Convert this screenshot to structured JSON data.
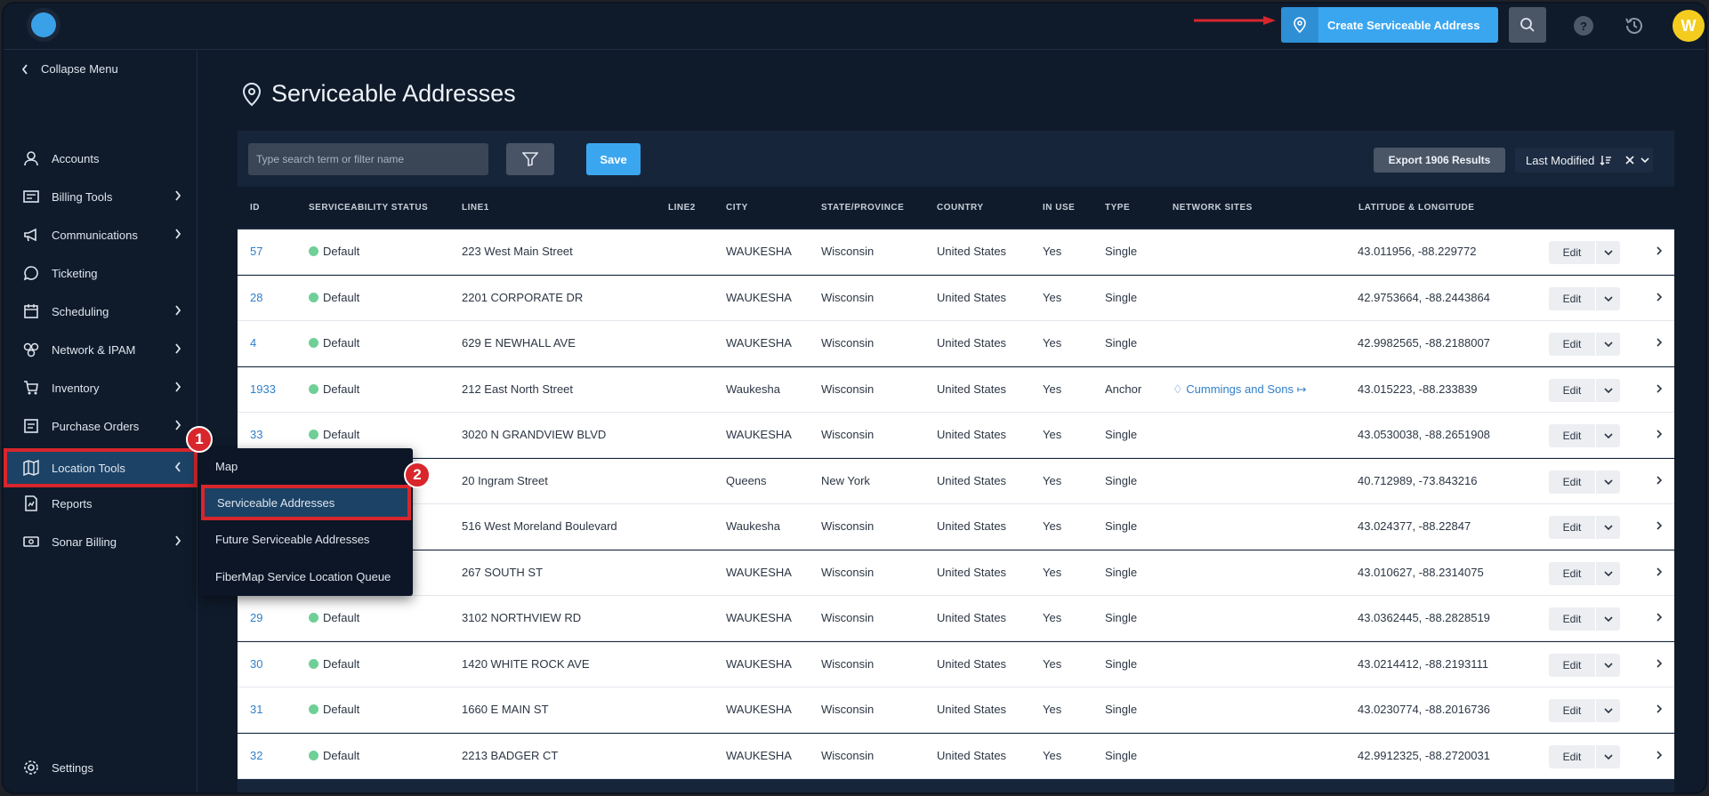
{
  "topbar": {
    "create_label": "Create Serviceable Address",
    "help_label": "?",
    "avatar_initial": "W",
    "accent_color": "#3ba6f0"
  },
  "sidebar": {
    "collapse_label": "Collapse Menu",
    "items": [
      {
        "label": "Accounts",
        "icon": "user-icon",
        "chevron": false
      },
      {
        "label": "Billing Tools",
        "icon": "billing-icon",
        "chevron": true
      },
      {
        "label": "Communications",
        "icon": "megaphone-icon",
        "chevron": true
      },
      {
        "label": "Ticketing",
        "icon": "chat-bubble-icon",
        "chevron": false
      },
      {
        "label": "Scheduling",
        "icon": "calendar-icon",
        "chevron": true
      },
      {
        "label": "Network & IPAM",
        "icon": "network-icon",
        "chevron": true
      },
      {
        "label": "Inventory",
        "icon": "cart-icon",
        "chevron": true
      },
      {
        "label": "Purchase Orders",
        "icon": "receipt-icon",
        "chevron": true
      },
      {
        "label": "Location Tools",
        "icon": "map-icon",
        "chevron": true
      },
      {
        "label": "Reports",
        "icon": "report-icon",
        "chevron": false
      },
      {
        "label": "Sonar Billing",
        "icon": "money-icon",
        "chevron": true
      }
    ],
    "settings_label": "Settings"
  },
  "flyout": {
    "items": [
      "Map",
      "Serviceable Addresses",
      "Future Serviceable Addresses",
      "FiberMap Service Location Queue"
    ]
  },
  "annotations": {
    "step1": "1",
    "step2": "2"
  },
  "page": {
    "title": "Serviceable Addresses",
    "search_placeholder": "Type search term or filter name",
    "save_label": "Save",
    "export_label": "Export 1906 Results",
    "sort_label": "Last Modified"
  },
  "table": {
    "headers": [
      "ID",
      "SERVICEABILITY STATUS",
      "LINE1",
      "LINE2",
      "CITY",
      "STATE/PROVINCE",
      "COUNTRY",
      "IN USE",
      "TYPE",
      "NETWORK SITES",
      "LATITUDE & LONGITUDE"
    ],
    "edit_label": "Edit",
    "rows": [
      {
        "id": "57",
        "status": "Default",
        "line1": "223 West Main Street",
        "city": "WAUKESHA",
        "state": "Wisconsin",
        "country": "United States",
        "in_use": "Yes",
        "type": "Single",
        "network": "",
        "latlng": "43.011956, -88.229772"
      },
      {
        "id": "28",
        "status": "Default",
        "line1": "2201 CORPORATE DR",
        "city": "WAUKESHA",
        "state": "Wisconsin",
        "country": "United States",
        "in_use": "Yes",
        "type": "Single",
        "network": "",
        "latlng": "42.9753664, -88.2443864"
      },
      {
        "id": "4",
        "status": "Default",
        "line1": "629 E NEWHALL AVE",
        "city": "WAUKESHA",
        "state": "Wisconsin",
        "country": "United States",
        "in_use": "Yes",
        "type": "Single",
        "network": "",
        "latlng": "42.9982565, -88.2188007"
      },
      {
        "id": "1933",
        "status": "Default",
        "line1": "212 East North Street",
        "city": "Waukesha",
        "state": "Wisconsin",
        "country": "United States",
        "in_use": "Yes",
        "type": "Anchor",
        "network": "Cummings and Sons",
        "latlng": "43.015223, -88.233839"
      },
      {
        "id": "33",
        "status": "Default",
        "line1": "3020 N GRANDVIEW BLVD",
        "city": "WAUKESHA",
        "state": "Wisconsin",
        "country": "United States",
        "in_use": "Yes",
        "type": "Single",
        "network": "",
        "latlng": "43.0530038, -88.2651908"
      },
      {
        "id": "",
        "status": "",
        "line1": "20 Ingram Street",
        "city": "Queens",
        "state": "New York",
        "country": "United States",
        "in_use": "Yes",
        "type": "Single",
        "network": "",
        "latlng": "40.712989, -73.843216"
      },
      {
        "id": "",
        "status": "",
        "line1": "516 West Moreland Boulevard",
        "city": "Waukesha",
        "state": "Wisconsin",
        "country": "United States",
        "in_use": "Yes",
        "type": "Single",
        "network": "",
        "latlng": "43.024377, -88.22847"
      },
      {
        "id": "",
        "status": "",
        "line1": "267 SOUTH ST",
        "city": "WAUKESHA",
        "state": "Wisconsin",
        "country": "United States",
        "in_use": "Yes",
        "type": "Single",
        "network": "",
        "latlng": "43.010627, -88.2314075"
      },
      {
        "id": "29",
        "status": "Default",
        "line1": "3102 NORTHVIEW RD",
        "city": "WAUKESHA",
        "state": "Wisconsin",
        "country": "United States",
        "in_use": "Yes",
        "type": "Single",
        "network": "",
        "latlng": "43.0362445, -88.2828519"
      },
      {
        "id": "30",
        "status": "Default",
        "line1": "1420 WHITE ROCK AVE",
        "city": "WAUKESHA",
        "state": "Wisconsin",
        "country": "United States",
        "in_use": "Yes",
        "type": "Single",
        "network": "",
        "latlng": "43.0214412, -88.2193111"
      },
      {
        "id": "31",
        "status": "Default",
        "line1": "1660 E MAIN ST",
        "city": "WAUKESHA",
        "state": "Wisconsin",
        "country": "United States",
        "in_use": "Yes",
        "type": "Single",
        "network": "",
        "latlng": "43.0230774, -88.2016736"
      },
      {
        "id": "32",
        "status": "Default",
        "line1": "2213 BADGER CT",
        "city": "WAUKESHA",
        "state": "Wisconsin",
        "country": "United States",
        "in_use": "Yes",
        "type": "Single",
        "network": "",
        "latlng": "42.9912325, -88.2720031"
      }
    ]
  }
}
